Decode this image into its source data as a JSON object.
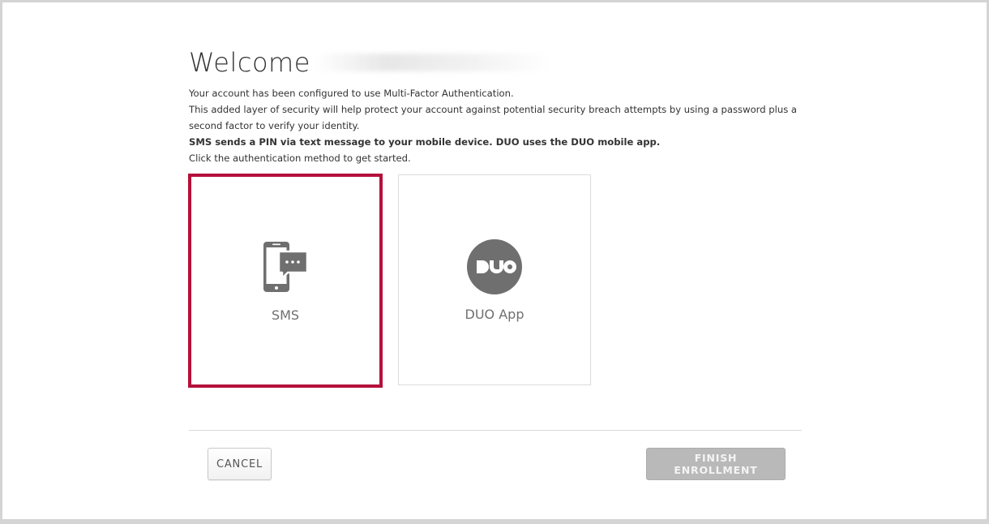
{
  "header": {
    "title": "Welcome"
  },
  "intro": {
    "line1": "Your account has been configured to use Multi-Factor Authentication.",
    "line2": "This added layer of security will help protect your account against potential security breach attempts by using a password plus a second factor to verify your identity.",
    "line3": "SMS sends a PIN via text message to your mobile device. DUO uses the DUO mobile app.",
    "line4": "Click the authentication method to get started."
  },
  "methods": [
    {
      "label": "SMS",
      "icon": "sms-phone-icon",
      "selected": true
    },
    {
      "label": "DUO App",
      "icon": "duo-logo-icon",
      "selected": false
    }
  ],
  "actions": {
    "cancel_label": "CANCEL",
    "finish_label": "FINISH ENROLLMENT"
  },
  "colors": {
    "selected_border": "#b5103b",
    "icon_gray": "#6f6f6f",
    "finish_disabled": "#b9b9b9"
  }
}
